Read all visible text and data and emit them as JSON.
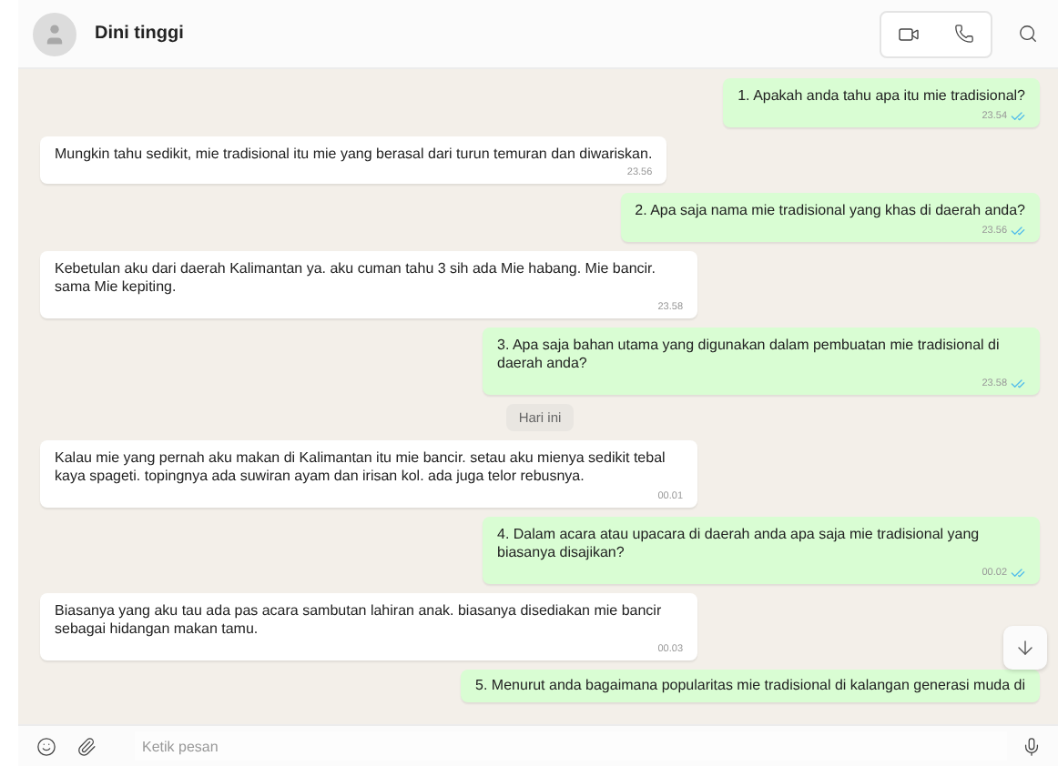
{
  "header": {
    "contact_name": "Dini tinggi"
  },
  "messages": [
    {
      "kind": "sent",
      "text": "1. Apakah anda tahu apa itu mie tradisional?",
      "time": "23.54"
    },
    {
      "kind": "received",
      "text": "Mungkin tahu sedikit, mie tradisional itu mie yang berasal dari turun temuran dan diwariskan.",
      "time": "23.56"
    },
    {
      "kind": "sent",
      "text": "2. Apa saja nama mie tradisional yang khas di daerah anda?",
      "time": "23.56"
    },
    {
      "kind": "received",
      "text": "Kebetulan aku dari daerah Kalimantan ya. aku cuman tahu 3 sih ada Mie habang. Mie bancir. sama Mie kepiting.",
      "time": "23.58"
    },
    {
      "kind": "sent",
      "text": "3. Apa saja bahan utama yang digunakan dalam pembuatan mie tradisional di daerah anda?",
      "time": "23.58"
    },
    {
      "kind": "date",
      "text": "Hari ini"
    },
    {
      "kind": "received",
      "text": "Kalau mie yang pernah aku makan di Kalimantan itu mie bancir. setau aku mienya sedikit tebal kaya spageti. topingnya ada suwiran ayam dan irisan kol. ada juga telor rebusnya.",
      "time": "00.01"
    },
    {
      "kind": "sent",
      "text": "4. Dalam acara atau upacara di daerah anda apa saja mie tradisional yang biasanya disajikan?",
      "time": "00.02"
    },
    {
      "kind": "received",
      "text": "Biasanya yang aku tau ada pas acara sambutan lahiran anak. biasanya disediakan mie bancir sebagai hidangan makan tamu.",
      "time": "00.03"
    },
    {
      "kind": "sent",
      "text": "5. Menurut anda bagaimana popularitas mie tradisional di kalangan generasi muda di"
    }
  ],
  "composer": {
    "placeholder": "Ketik pesan"
  }
}
